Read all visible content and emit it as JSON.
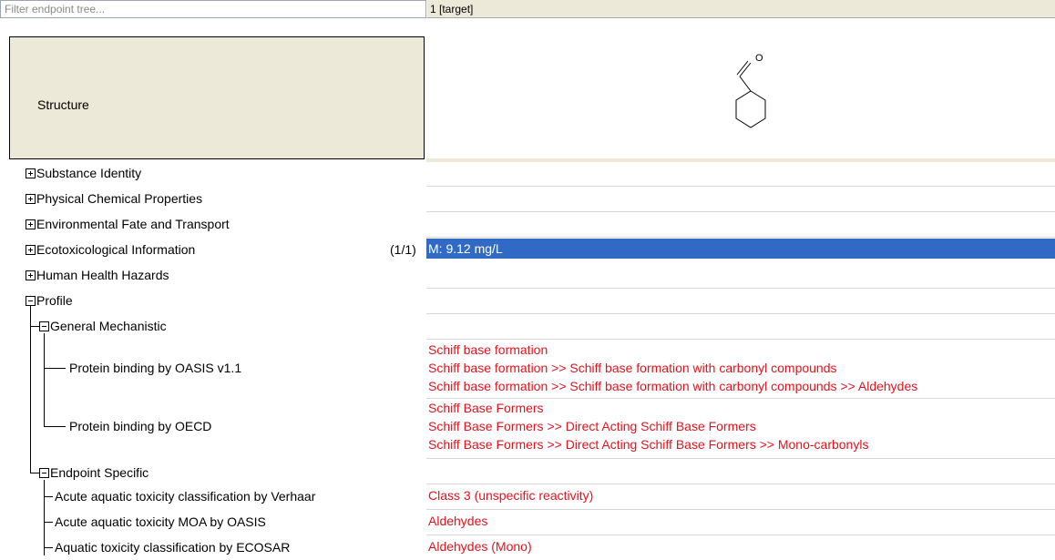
{
  "filter": {
    "placeholder": "Filter endpoint tree..."
  },
  "column": {
    "header": "1 [target]"
  },
  "structure": {
    "label": "Structure",
    "atom": "O"
  },
  "tree": {
    "substance_identity": "Substance Identity",
    "physical_chemical": "Physical Chemical Properties",
    "environmental_fate": "Environmental Fate and Transport",
    "ecotox": "Ecotoxicological Information",
    "ecotox_count": "(1/1)",
    "human_health": "Human Health Hazards",
    "profile": "Profile",
    "general_mechanistic": "General Mechanistic",
    "pb_oasis": "Protein binding by OASIS v1.1",
    "pb_oecd": "Protein binding by OECD",
    "endpoint_specific": "Endpoint Specific",
    "verhaar": "Acute aquatic toxicity classification by Verhaar",
    "moa_oasis": "Acute aquatic toxicity MOA by OASIS",
    "ecosar": "Aquatic toxicity classification by ECOSAR"
  },
  "values": {
    "ecotox": "M: 9.12 mg/L",
    "pb_oasis": [
      "Schiff base formation",
      "Schiff base formation >> Schiff base formation with carbonyl compounds",
      "Schiff base formation >> Schiff base formation with carbonyl compounds >> Aldehydes"
    ],
    "pb_oecd": [
      "Schiff Base Formers",
      "Schiff Base Formers >> Direct Acting Schiff Base Formers",
      "Schiff Base Formers >> Direct Acting Schiff Base Formers >> Mono-carbonyls"
    ],
    "verhaar": "Class 3 (unspecific reactivity)",
    "moa_oasis": "Aldehydes",
    "ecosar": "Aldehydes (Mono)"
  },
  "colors": {
    "selection": "#316ac5",
    "profile_text": "#e0141e",
    "header_bg": "#ece9d8"
  }
}
